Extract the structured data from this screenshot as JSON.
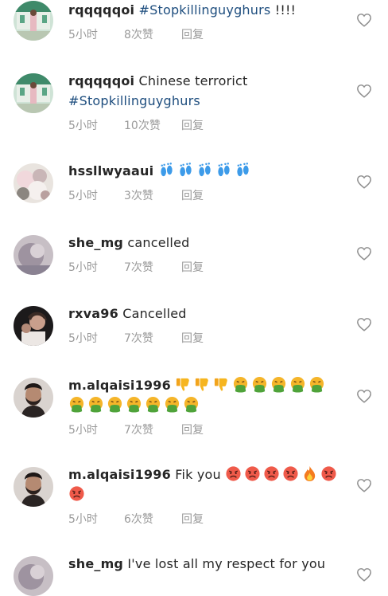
{
  "reply_label": "回复",
  "comments": [
    {
      "username": "rqqqqqoi",
      "text": "",
      "hashtag": "#Stopkillinguyghurs",
      "after": "!!!!",
      "time": "5小时",
      "likes": "8次赞"
    },
    {
      "username": "rqqqqqoi",
      "text": "Chinese terrorict",
      "hashtag": "#Stopkillinguyghurs",
      "after": "",
      "time": "5小时",
      "likes": "10次赞"
    },
    {
      "username": "hssllwyaaui",
      "text": "",
      "emojis": [
        "footprints",
        "footprints",
        "footprints",
        "footprints",
        "footprints"
      ],
      "time": "5小时",
      "likes": "3次赞"
    },
    {
      "username": "she_mg",
      "text": "cancelled",
      "time": "5小时",
      "likes": "7次赞"
    },
    {
      "username": "rxva96",
      "text": "Cancelled",
      "time": "5小时",
      "likes": "7次赞"
    },
    {
      "username": "m.alqaisi1996",
      "text": "",
      "emojis": [
        "thumbs-down",
        "thumbs-down",
        "thumbs-down",
        "vomiting-face",
        "vomiting-face",
        "vomiting-face",
        "vomiting-face",
        "vomiting-face",
        "vomiting-face",
        "vomiting-face",
        "vomiting-face",
        "vomiting-face",
        "vomiting-face",
        "vomiting-face",
        "vomiting-face"
      ],
      "time": "5小时",
      "likes": "7次赞"
    },
    {
      "username": "m.alqaisi1996",
      "text": "Fik you",
      "emojis": [
        "angry-face",
        "angry-face",
        "angry-face",
        "angry-face",
        "fire",
        "angry-face",
        "angry-face"
      ],
      "time": "5小时",
      "likes": "6次赞"
    },
    {
      "username": "she_mg",
      "text": "I've lost all my respect for you"
    }
  ]
}
